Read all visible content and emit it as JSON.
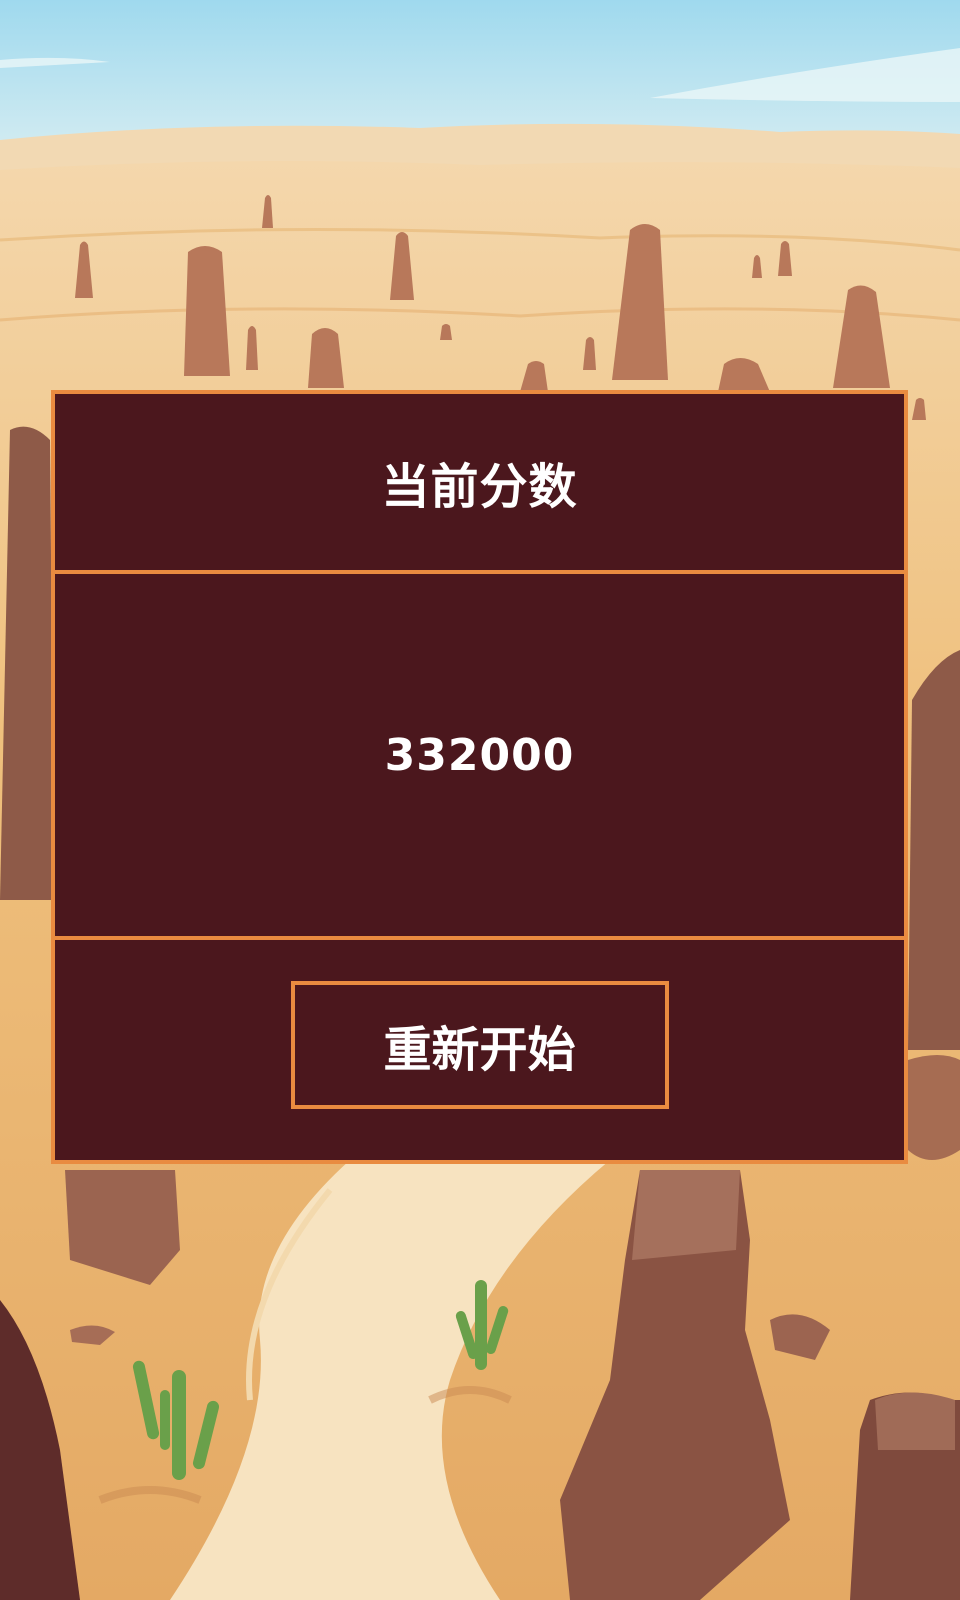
{
  "score_panel": {
    "title": "当前分数",
    "score": "332000",
    "restart_label": "重新开始"
  },
  "colors": {
    "panel_background": "#4b171d",
    "panel_border": "#e98b40",
    "text": "#ffffff"
  }
}
